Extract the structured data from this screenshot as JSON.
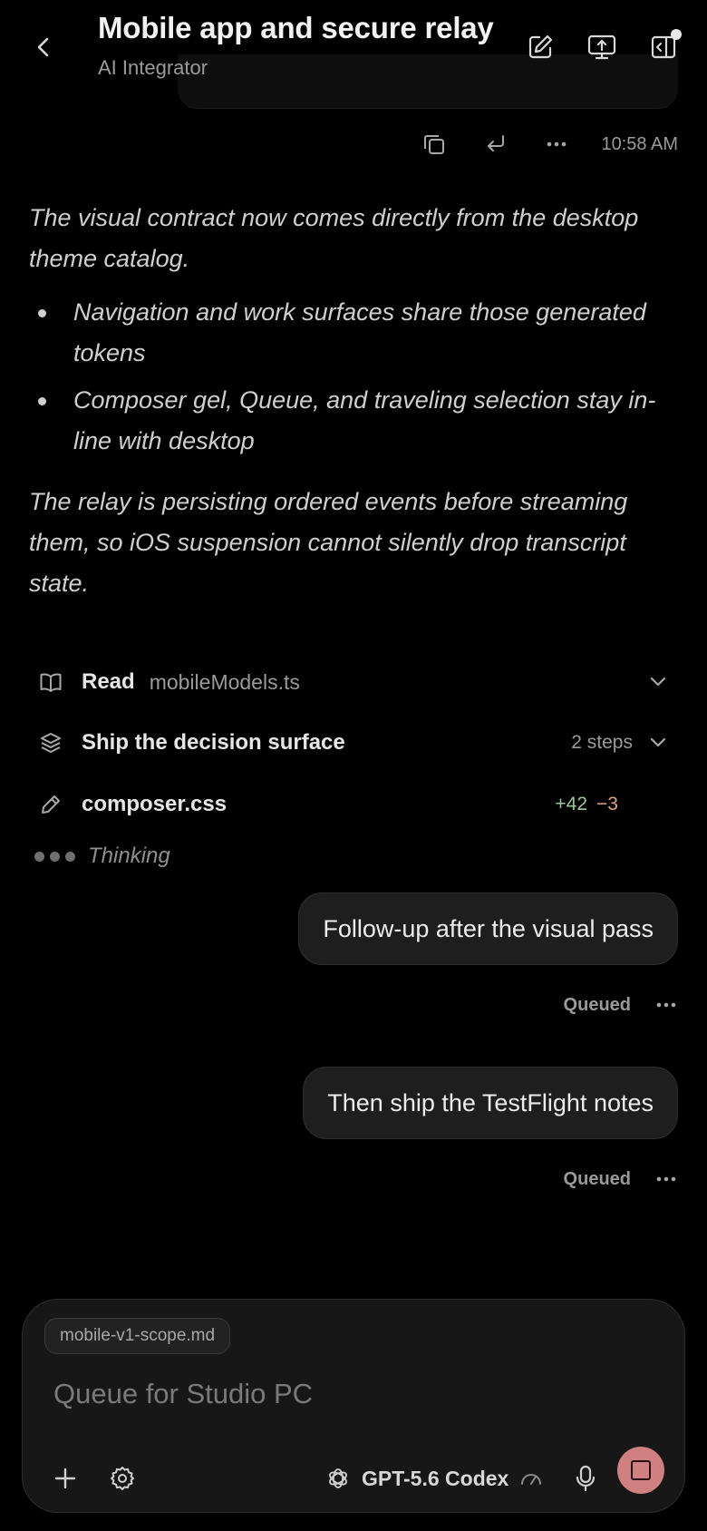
{
  "header": {
    "title": "Mobile app and secure relay",
    "subtitle": "AI Integrator"
  },
  "message_meta": {
    "time": "10:58 AM"
  },
  "assistant": {
    "para1": "The visual contract now comes directly from the desktop theme catalog.",
    "bullets": [
      "Navigation and work surfaces share those generated tokens",
      "Composer gel, Queue, and traveling selection stay in-line with desktop"
    ],
    "para2": "The relay is persisting ordered events before streaming them, so iOS suspension cannot silently drop transcript state."
  },
  "activity": {
    "read": {
      "label": "Read",
      "file": "mobileModels.ts"
    },
    "plan": {
      "label": "Ship the decision surface",
      "steps": "2 steps"
    },
    "edit": {
      "label": "composer.css",
      "added": "+42",
      "removed": "−3"
    },
    "thinking": "Thinking"
  },
  "queue": [
    {
      "text": "Follow-up after the visual pass",
      "status": "Queued"
    },
    {
      "text": "Then ship the TestFlight notes",
      "status": "Queued"
    }
  ],
  "composer": {
    "attachment": "mobile-v1-scope.md",
    "placeholder": "Queue for Studio PC",
    "model": "GPT-5.6 Codex"
  },
  "colors": {
    "background": "#000000",
    "bubble": "#1e1e1e",
    "added": "#9bc59b",
    "removed": "#e0a07e",
    "stop_button": "#d08080"
  },
  "icons": [
    "back-chevron-icon",
    "edit-icon",
    "monitor-upload-icon",
    "code-panel-icon",
    "copy-icon",
    "reply-icon",
    "more-icon",
    "book-icon",
    "layers-icon",
    "pencil-icon",
    "plus-icon",
    "gear-icon",
    "openai-logo-icon",
    "speed-gauge-icon",
    "microphone-icon",
    "stop-icon"
  ]
}
